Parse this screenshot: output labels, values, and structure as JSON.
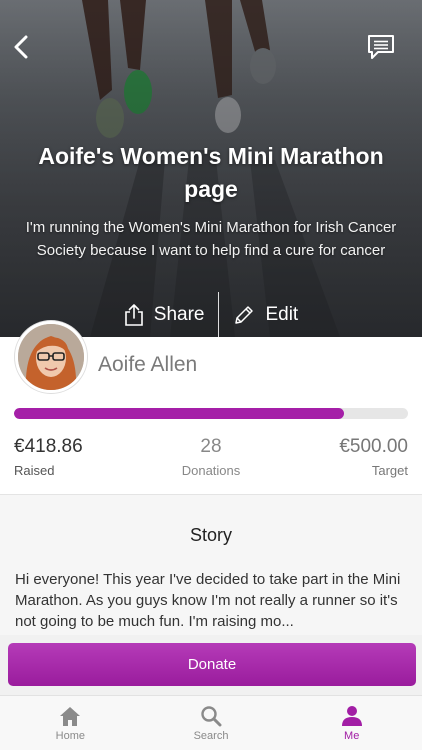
{
  "hero": {
    "title": "Aoife's Women's Mini Marathon page",
    "subtitle": "I'm running the Women's Mini Marathon for Irish Cancer Society because I want to help find a cure for cancer",
    "share_label": "Share",
    "edit_label": "Edit"
  },
  "profile": {
    "name": "Aoife Allen",
    "progress_fraction": 0.837,
    "raised_value": "€418.86",
    "raised_label": "Raised",
    "donations_value": "28",
    "donations_label": "Donations",
    "target_value": "€500.00",
    "target_label": "Target"
  },
  "story": {
    "title": "Story",
    "body": "Hi everyone! This year I've decided to take part in the Mini Marathon. As you guys know I'm not really a runner so it's not going to be much fun. I'm raising mo..."
  },
  "donate": {
    "label": "Donate"
  },
  "tabs": [
    {
      "label": "Home",
      "icon": "home-icon",
      "active": false
    },
    {
      "label": "Search",
      "icon": "search-icon",
      "active": false
    },
    {
      "label": "Me",
      "icon": "person-icon",
      "active": true
    }
  ],
  "colors": {
    "accent": "#a21ea5",
    "accent_light": "#b53bb8"
  }
}
